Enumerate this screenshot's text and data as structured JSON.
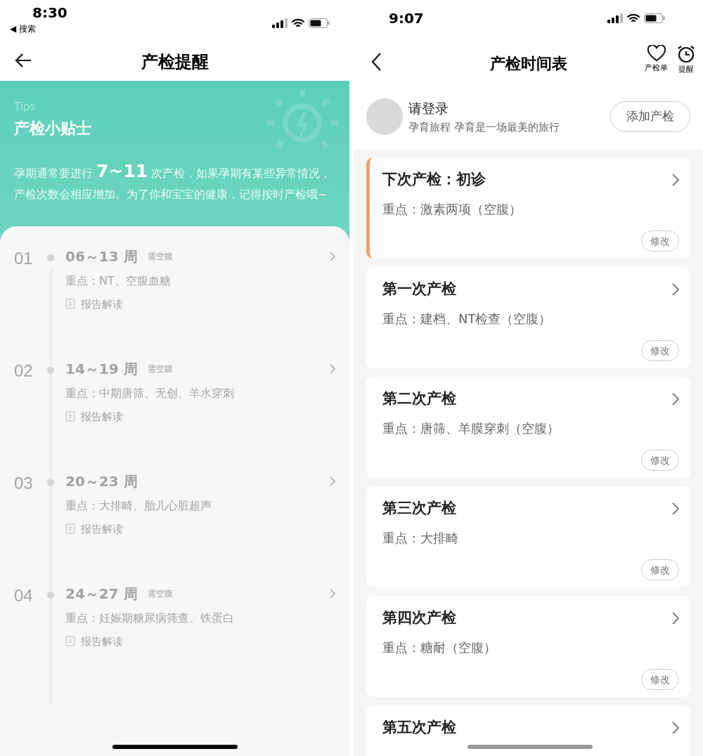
{
  "left": {
    "status_bar": {
      "time": "8:30",
      "back_app": "◀ 搜索"
    },
    "nav": {
      "title": "产检提醒"
    },
    "tips": {
      "label": "Tips",
      "title": "产检小贴士",
      "text_before": "孕期通常要进行",
      "highlight": "7~11",
      "text_after": "次产检，如果孕期有某些异常情况，产检次数会相应增加。为了你和宝宝的健康，记得按时产检哦~"
    },
    "timeline": [
      {
        "number": "01",
        "weeks": "06～13 周",
        "tag": "需空腹",
        "focus": "重点：NT、空腹血糖",
        "report": "报告解读"
      },
      {
        "number": "02",
        "weeks": "14～19 周",
        "tag": "需空腹",
        "focus": "重点：中期唐筛、无创、羊水穿刺",
        "report": "报告解读"
      },
      {
        "number": "03",
        "weeks": "20～23 周",
        "focus": "重点：大排畸、胎儿心脏超声",
        "report": "报告解读"
      },
      {
        "number": "04",
        "weeks": "24～27 周",
        "tag": "需空腹",
        "focus": "重点：妊娠期糖尿病筛查、铁蛋白",
        "report": "报告解读"
      }
    ]
  },
  "right": {
    "status_bar": {
      "time": "9:07"
    },
    "nav": {
      "title": "产检时间表",
      "actions": [
        {
          "kind": "heart",
          "label": "产检单"
        },
        {
          "kind": "alarm",
          "label": "提醒"
        }
      ]
    },
    "user": {
      "name": "请登录",
      "subtitle": "孕育旅程 孕育是一场最美的旅行",
      "button": "添加产检"
    },
    "checkups": [
      {
        "title": "下次产检：初诊",
        "focus": "重点：激素两项（空腹）",
        "edit": "修改",
        "current": true
      },
      {
        "title": "第一次产检",
        "focus": "重点：建档、NT检查（空腹）",
        "edit": "修改",
        "current": false
      },
      {
        "title": "第二次产检",
        "focus": "重点：唐筛、羊膜穿刺（空腹）",
        "edit": "修改",
        "current": false
      },
      {
        "title": "第三次产检",
        "focus": "重点：大排畸",
        "edit": "修改",
        "current": false
      },
      {
        "title": "第四次产检",
        "focus": "重点：糖耐（空腹）",
        "edit": "修改",
        "current": false
      },
      {
        "title": "第五次产检",
        "current": false
      }
    ]
  }
}
